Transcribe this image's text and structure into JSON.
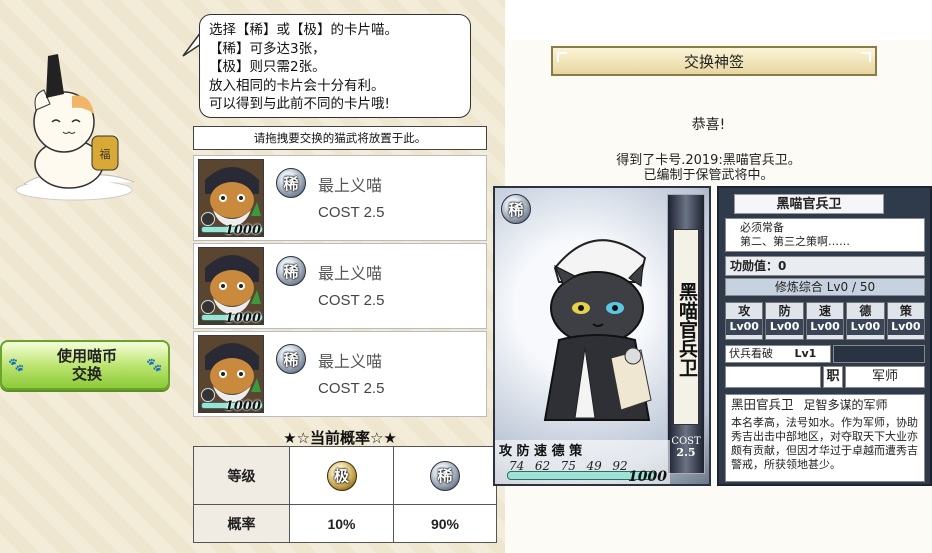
{
  "bubble": {
    "lines": [
      "选择【稀】或【极】的卡片喵。",
      "【稀】可多达3张，",
      "【极】则只需2张。",
      "放入相同的卡片会十分有利。",
      "可以得到与此前不同的卡片哦!"
    ]
  },
  "drop_hint": "请拖拽要交换的猫武将放置于此。",
  "selected_cards": [
    {
      "rarity": "稀",
      "skill": "最上义喵",
      "cost": "COST 2.5",
      "hp": "1000"
    },
    {
      "rarity": "稀",
      "skill": "最上义喵",
      "cost": "COST 2.5",
      "hp": "1000"
    },
    {
      "rarity": "稀",
      "skill": "最上义喵",
      "cost": "COST 2.5",
      "hp": "1000"
    }
  ],
  "exchange_button": {
    "line1": "使用喵币",
    "line2": "交换"
  },
  "rate_table": {
    "title": "★☆当前概率☆★",
    "row_grade_label": "等级",
    "row_rate_label": "概率",
    "columns": [
      {
        "grade": "极",
        "rate": "10%"
      },
      {
        "grade": "稀",
        "rate": "90%"
      }
    ]
  },
  "dialog": {
    "title": "交换神签",
    "congrats": "恭喜!",
    "obtain_line1": "得到了卡号.2019:黑喵官兵卫。",
    "obtain_line2": "已编制于保管武将中。"
  },
  "result_card": {
    "rarity": "稀",
    "name_vertical": "黑喵官兵卫",
    "cost_label": "COST",
    "cost_value": "2.5",
    "stat_labels": "攻 防 速 德 策",
    "stats": [
      "74",
      "62",
      "75",
      "49",
      "92"
    ],
    "hp": "1000"
  },
  "info": {
    "name": "黑喵官兵卫",
    "skill_title": "必须常备",
    "skill_desc": "第二、第三之策啊……",
    "merit": "功勋值：0",
    "training": "修炼综合  Lv0 / 50",
    "attrs": [
      {
        "label": "攻",
        "lv": "Lv00"
      },
      {
        "label": "防",
        "lv": "Lv00"
      },
      {
        "label": "速",
        "lv": "Lv00"
      },
      {
        "label": "德",
        "lv": "Lv00"
      },
      {
        "label": "策",
        "lv": "Lv00"
      }
    ],
    "troop": "伏兵看破",
    "troop_lv": "Lv1",
    "role_label": "职",
    "role": "军师",
    "bio_name": "黑田官兵卫",
    "bio_tag": "足智多谋的军师",
    "bio_text": "本名孝高，法号如水。作为军师，协助秀吉出击中部地区，对夺取天下大业亦颇有贡献，但因才华过于卓越而遭秀吉警戒，所获领地甚少。"
  }
}
